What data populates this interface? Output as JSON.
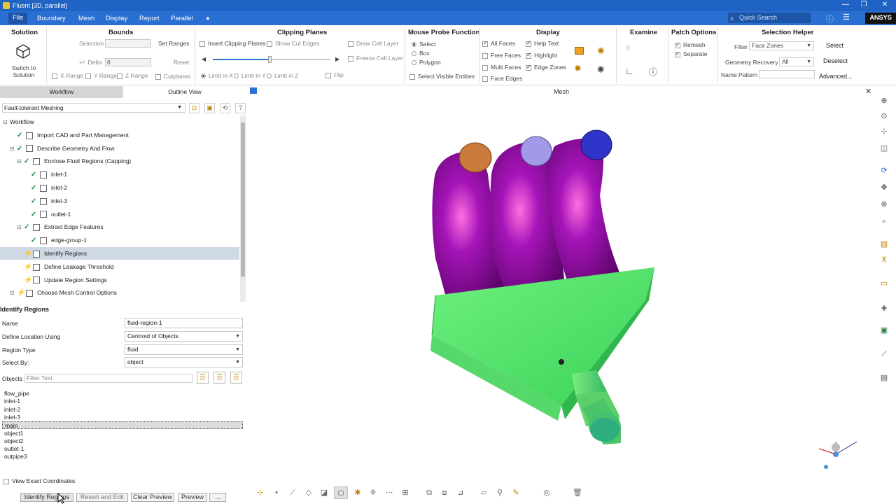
{
  "window": {
    "title": "Fluent [3D, parallel]",
    "min": "—",
    "max": "❐",
    "close": "✕"
  },
  "menu": {
    "items": [
      "File",
      "Boundary",
      "Mesh",
      "Display",
      "Report",
      "Parallel",
      "▲"
    ],
    "search_placeholder": "Quick Search",
    "brand": "ANSYS"
  },
  "ribbon": {
    "solution": {
      "title": "Solution",
      "button": "Switch to\nSolution"
    },
    "bounds": {
      "title": "Bounds",
      "selection": "Selection",
      "set_ranges": "Set Ranges",
      "delta": "+/- Delta",
      "delta_value": "0",
      "reset": "Reset",
      "x_range": "X Range",
      "y_range": "Y Range",
      "z_range": "Z Range",
      "cutplanes": "Cutplanes"
    },
    "clipping": {
      "title": "Clipping Planes",
      "insert": "Insert Clipping Planes",
      "show_cut": "Show Cut Edges",
      "draw_cell": "Draw Cell Layer",
      "freeze_cell": "Freeze Cell Layer",
      "limit_x": "Limit in X",
      "limit_y": "Limit in Y",
      "limit_z": "Limit in Z",
      "flip": "Flip",
      "slider_value": 0.47
    },
    "probe": {
      "title": "Mouse Probe Function",
      "select": "Select",
      "box": "Box",
      "polygon": "Polygon",
      "visible": "Select Visible Entities"
    },
    "display": {
      "title": "Display",
      "all_faces": "All Faces",
      "free_faces": "Free Faces",
      "multi_faces": "Multi Faces",
      "face_edges": "Face Edges",
      "help_text": "Help Text",
      "highlight": "Highlight",
      "edge_zones": "Edge Zones"
    },
    "examine": {
      "title": "Examine"
    },
    "patch": {
      "title": "Patch Options",
      "remesh": "Remesh",
      "separate": "Separate"
    },
    "helper": {
      "title": "Selection Helper",
      "filter_label": "Filter",
      "filter_value": "Face Zones",
      "select": "Select",
      "geom_label": "Geometry Recovery",
      "geom_value": "All",
      "deselect": "Deselect",
      "name_pattern": "Name Pattern",
      "advanced": "Advanced..."
    }
  },
  "left": {
    "tabs": [
      "Workflow",
      "Outline View"
    ],
    "workflow_type": "Fault-tolerant Meshing",
    "tree": [
      {
        "label": "Workflow",
        "indent": 0,
        "mark": "",
        "exp": "⊟"
      },
      {
        "label": "Import CAD and Part Management",
        "indent": 1,
        "mark": "check"
      },
      {
        "label": "Describe Geometry And Flow",
        "indent": 1,
        "mark": "check",
        "exp": "⊟"
      },
      {
        "label": "Enclose Fluid Regions (Capping)",
        "indent": 2,
        "mark": "check",
        "exp": "⊟"
      },
      {
        "label": "inlet-1",
        "indent": 3,
        "mark": "check"
      },
      {
        "label": "inlet-2",
        "indent": 3,
        "mark": "check"
      },
      {
        "label": "inlet-3",
        "indent": 3,
        "mark": "check"
      },
      {
        "label": "outlet-1",
        "indent": 3,
        "mark": "check"
      },
      {
        "label": "Extract Edge Features",
        "indent": 2,
        "mark": "check",
        "exp": "⊟"
      },
      {
        "label": "edge-group-1",
        "indent": 3,
        "mark": "check"
      },
      {
        "label": "Identify Regions",
        "indent": 2,
        "mark": "bolt",
        "sel": true
      },
      {
        "label": "Define Leakage Threshold",
        "indent": 2,
        "mark": "bolt"
      },
      {
        "label": "Update Region Settings",
        "indent": 2,
        "mark": "bolt"
      },
      {
        "label": "Choose Mesh Control Options",
        "indent": 1,
        "mark": "bolt",
        "exp": "⊟"
      },
      {
        "label": "Setup Size Controls",
        "indent": 2,
        "mark": "bolt"
      }
    ],
    "task_title": "Identify Regions",
    "form": {
      "name_label": "Name",
      "name_value": "fluid-region-1",
      "define_label": "Define Location Using",
      "define_value": "Centroid of Objects",
      "type_label": "Region Type",
      "type_value": "fluid",
      "selectby_label": "Select By:",
      "selectby_value": "object",
      "objects_label": "Objects",
      "filter_placeholder": "Filter Text"
    },
    "objects": [
      "flow_pipe",
      "inlet-1",
      "inlet-2",
      "inlet-3",
      "main",
      "object1",
      "object2",
      "outlet-1",
      "outpipe3"
    ],
    "selected_object": "main",
    "exact_coords": "View Exact Coordinates",
    "buttons": [
      "Identify Regions",
      "Revert and Edit",
      "Clear Preview",
      "Preview",
      "..."
    ]
  },
  "viewport": {
    "title": "Mesh"
  },
  "colors": {
    "titlebar": "#1f63c4",
    "menubar": "#2a6fd2",
    "pipe": "#8a0aa0",
    "box": "#4fe06c",
    "cap1": "#c97a3c",
    "cap2": "#a29ae8",
    "cap3": "#2f35c9"
  }
}
